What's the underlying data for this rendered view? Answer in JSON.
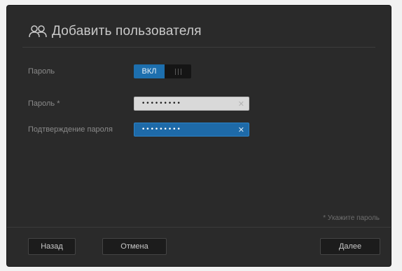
{
  "dialog": {
    "title": "Добавить пользователя",
    "title_icon": "users-icon"
  },
  "form": {
    "password_toggle": {
      "label": "Пароль",
      "on_label": "ВКЛ",
      "state": "on"
    },
    "password": {
      "label": "Пароль *",
      "value": "•••••••••",
      "clear_icon": "close-icon"
    },
    "password_confirm": {
      "label": "Подтверждение пароля",
      "value": "•••••••••",
      "clear_icon": "close-icon"
    },
    "hint": "* Укажите пароль"
  },
  "footer": {
    "back_label": "Назад",
    "cancel_label": "Отмена",
    "next_label": "Далее"
  },
  "colors": {
    "dialog_bg": "#2a2a2a",
    "accent": "#1d6fae",
    "text_muted": "#8a8a8a"
  }
}
